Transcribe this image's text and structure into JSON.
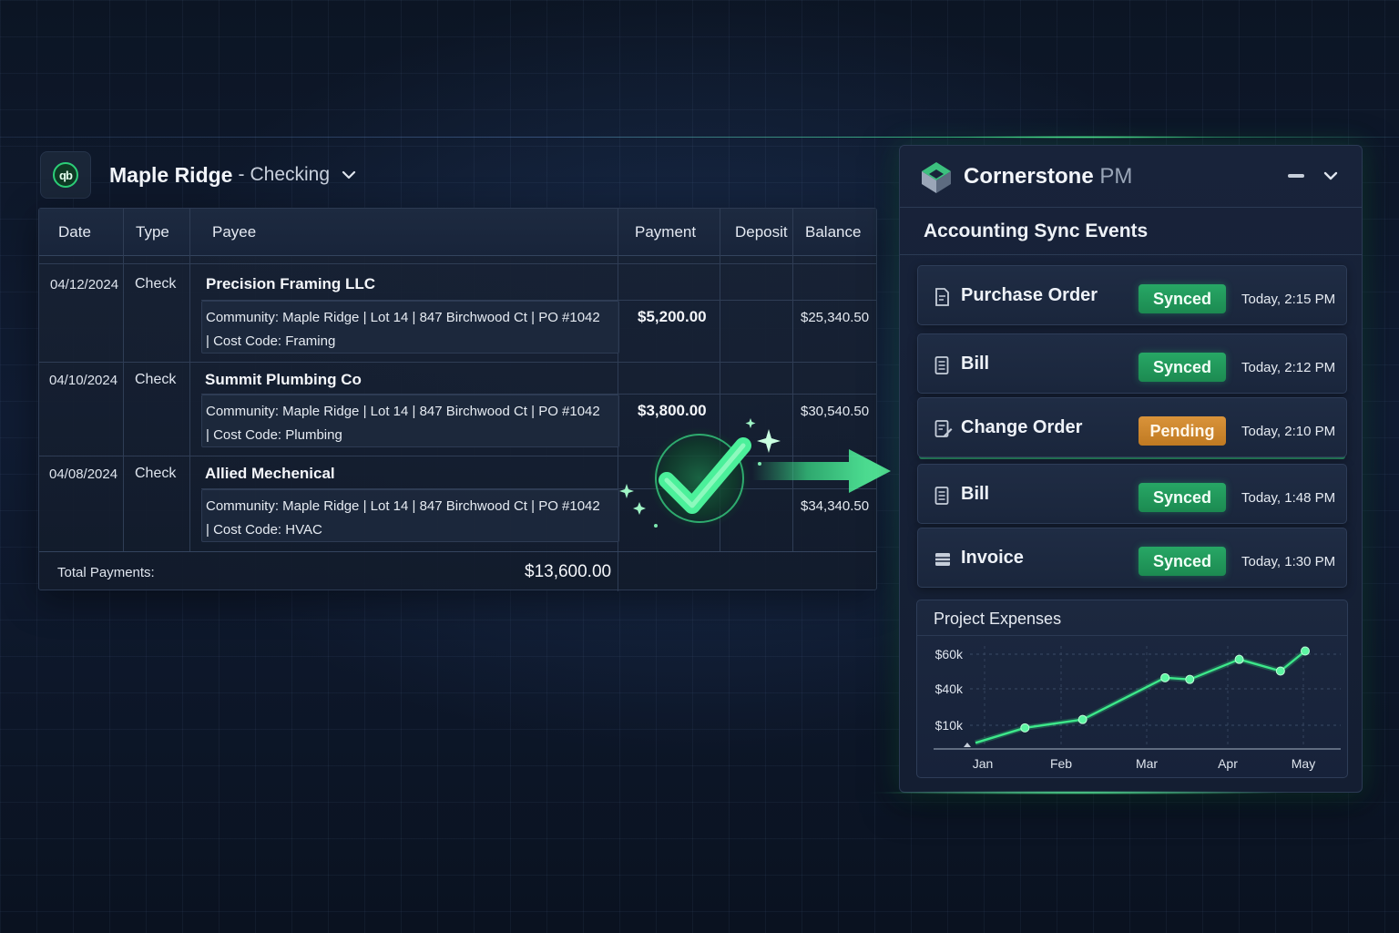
{
  "account": {
    "logo_text": "qb",
    "name": "Maple Ridge",
    "separator": "-",
    "account_type": "Checking"
  },
  "register": {
    "columns": {
      "date": "Date",
      "type": "Type",
      "payee": "Payee",
      "payment": "Payment",
      "deposit": "Deposit",
      "balance": "Balance"
    },
    "rows": [
      {
        "date": "04/12/2024",
        "type": "Check",
        "payee": "Precision Framing LLC",
        "memo_line1": "Community: Maple Ridge | Lot 14  | 847 Birchwood Ct | PO #1042",
        "memo_line2": "| Cost Code: Framing",
        "payment": "$5,200.00",
        "deposit": "",
        "balance": "$25,340.50"
      },
      {
        "date": "04/10/2024",
        "type": "Check",
        "payee": "Summit Plumbing Co",
        "memo_line1": "Community: Maple Ridge | Lot 14  | 847 Birchwood Ct | PO #1042",
        "memo_line2": "| Cost Code: Plumbing",
        "payment": "$3,800.00",
        "deposit": "",
        "balance": "$30,540.50"
      },
      {
        "date": "04/08/2024",
        "type": "Check",
        "payee": "Allied Mechenical",
        "memo_line1": "Community: Maple Ridge | Lot 14  | 847 Birchwood Ct | PO #1042",
        "memo_line2": "| Cost Code: HVAC",
        "payment": "",
        "deposit": "",
        "balance": "$34,340.50"
      }
    ],
    "total_label": "Total Payments:",
    "total_value": "$13,600.00"
  },
  "panel": {
    "brand": "Cornerstone",
    "brand_suffix": "PM",
    "section_title": "Accounting Sync Events",
    "events": [
      {
        "name": "Purchase Order",
        "status": "Synced",
        "time": "Today, 2:15 PM",
        "icon": "document-icon"
      },
      {
        "name": "Bill",
        "status": "Synced",
        "time": "Today, 2:12 PM",
        "icon": "bill-icon"
      },
      {
        "name": "Change Order",
        "status": "Pending",
        "time": "Today, 2:10 PM",
        "icon": "change-order-icon"
      },
      {
        "name": "Bill",
        "status": "Synced",
        "time": "Today, 1:48 PM",
        "icon": "bill-icon"
      },
      {
        "name": "Invoice",
        "status": "Synced",
        "time": "Today, 1:30 PM",
        "icon": "invoice-icon"
      }
    ]
  },
  "colors": {
    "accent_green": "#2ccf78",
    "synced": "#23995c",
    "pending": "#d08a30",
    "background": "#101c33"
  },
  "chart_data": {
    "type": "line",
    "title": "Project Expenses",
    "x_tick_labels": [
      "Jan",
      "Feb",
      "Mar",
      "Apr",
      "May"
    ],
    "y_tick_labels": [
      "$10k",
      "$40k",
      "$60k"
    ],
    "grid": true,
    "series": [
      {
        "points": [
          {
            "x": 0.0,
            "y": 2
          },
          {
            "x": 0.6,
            "y": 11
          },
          {
            "x": 1.3,
            "y": 16
          },
          {
            "x": 2.3,
            "y": 41
          },
          {
            "x": 2.6,
            "y": 40
          },
          {
            "x": 3.2,
            "y": 52
          },
          {
            "x": 3.7,
            "y": 45
          },
          {
            "x": 4.0,
            "y": 57
          }
        ]
      }
    ]
  }
}
